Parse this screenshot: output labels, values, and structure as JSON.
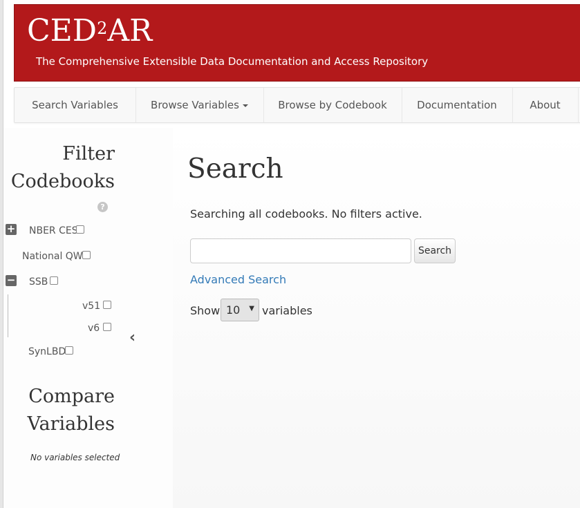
{
  "header": {
    "logo_main": "CED",
    "logo_sup": "2",
    "logo_tail": "AR",
    "tagline": "The Comprehensive Extensible Data Documentation and Access Repository"
  },
  "nav": {
    "items": [
      {
        "label": "Search Variables"
      },
      {
        "label": "Browse Variables"
      },
      {
        "label": "Browse by Codebook"
      },
      {
        "label": "Documentation"
      },
      {
        "label": "About"
      }
    ]
  },
  "sidebar": {
    "filter_title_line1": "Filter",
    "filter_title_line2": "Codebooks",
    "help_glyph": "?",
    "codebooks": [
      {
        "label": "NBER CES",
        "expander": "+"
      },
      {
        "label": "National QWI"
      },
      {
        "label": "SSB",
        "expander": "−"
      },
      {
        "label": "v51"
      },
      {
        "label": "v6"
      },
      {
        "label": "SynLBD"
      }
    ],
    "collapse_glyph": "‹",
    "compare_title_line1": "Compare",
    "compare_title_line2": "Variables",
    "no_vars_text": "No variables selected"
  },
  "main": {
    "title": "Search",
    "status": "Searching all codebooks. No filters active.",
    "search_input_value": "",
    "search_button": "Search",
    "advanced_link": "Advanced Search",
    "show_label": "Show",
    "per_page": "10",
    "variables_label": "variables"
  },
  "colors": {
    "banner": "#b3191b",
    "link": "#337ab7"
  }
}
